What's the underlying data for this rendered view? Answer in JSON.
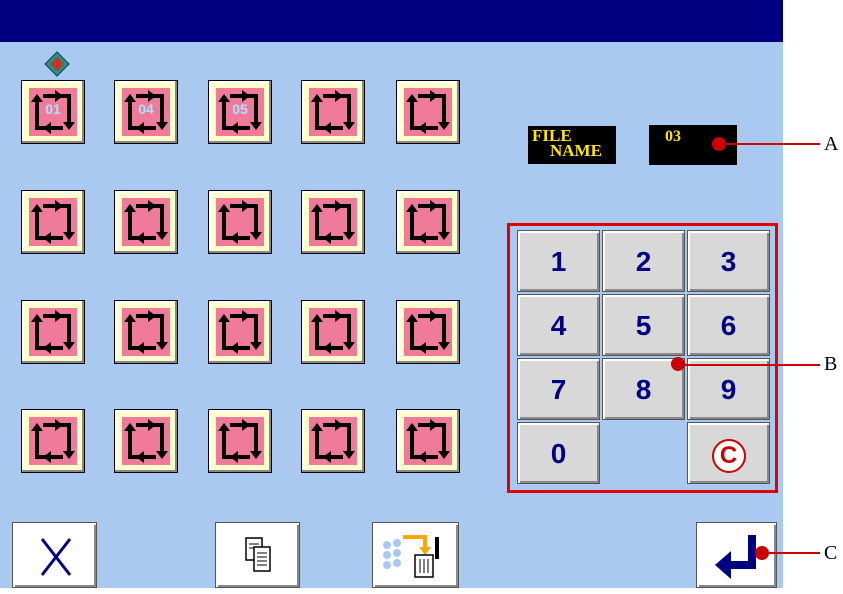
{
  "pattern_tiles": [
    "01",
    "04",
    "05",
    "",
    "",
    "",
    "",
    "",
    "",
    "",
    "",
    "",
    "",
    "",
    "",
    "",
    "",
    "",
    "",
    ""
  ],
  "file": {
    "name_label_line1": "FILE",
    "name_label_line2": "NAME",
    "value": "03"
  },
  "keypad": {
    "keys": [
      "1",
      "2",
      "3",
      "4",
      "5",
      "6",
      "7",
      "8",
      "9",
      "0",
      "",
      "C"
    ]
  },
  "callouts": {
    "a": "A",
    "b": "B",
    "c": "C"
  },
  "icons": {
    "cancel": "close-icon",
    "copy": "copy-icon",
    "delete": "delete-to-trash-icon",
    "enter": "enter-arrow-icon",
    "cube": "cube-icon"
  },
  "colors": {
    "title_bar": "#000080",
    "screen_bg": "#a9c9f0",
    "tile_pink": "#f07a9a",
    "callout_red": "#cc0000"
  }
}
